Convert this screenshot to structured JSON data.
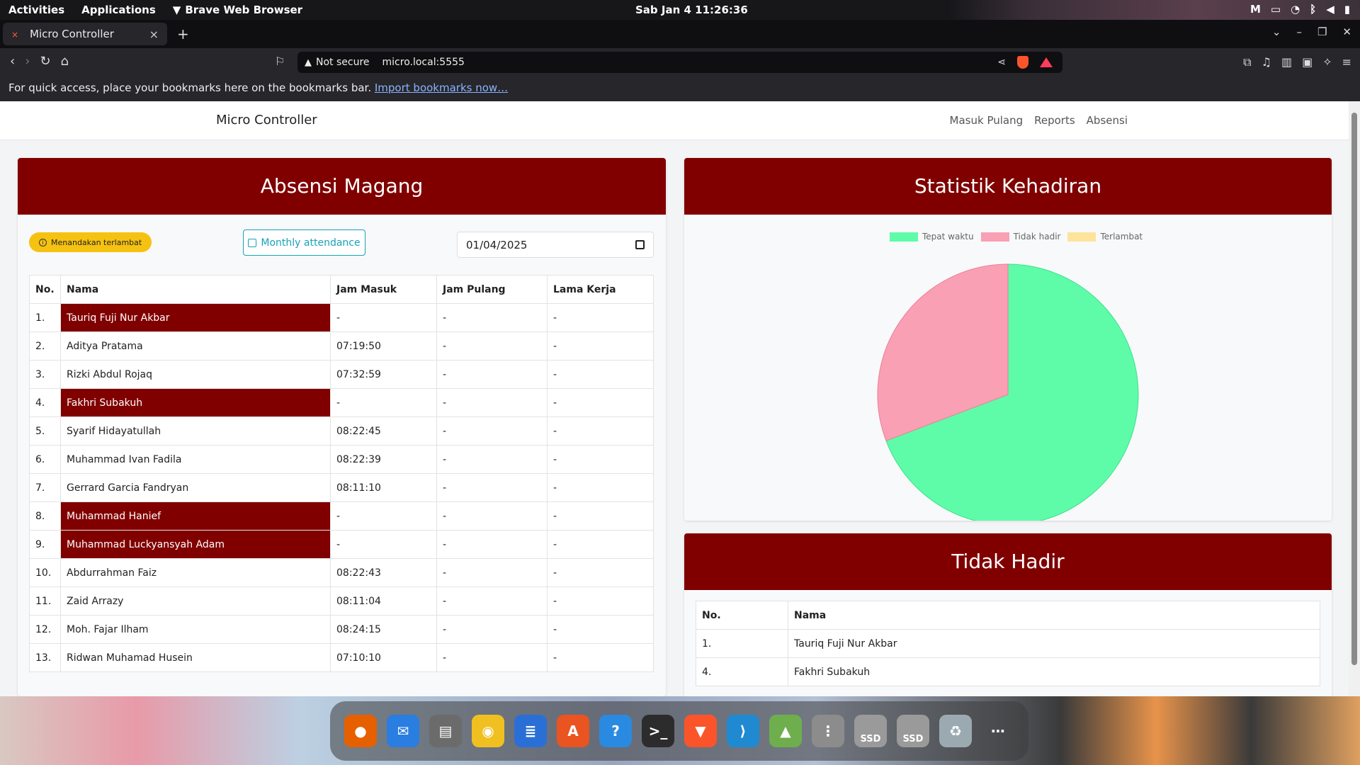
{
  "system": {
    "activities": "Activities",
    "applications": "Applications",
    "active_app": "Brave Web Browser",
    "clock": "Sab Jan 4  11:26:36"
  },
  "browser": {
    "tab_title": "Micro Controller",
    "not_secure": "Not secure",
    "url": "micro.local:5555",
    "bookmarks_text": "For quick access, place your bookmarks here on the bookmarks bar.",
    "bookmarks_link": "Import bookmarks now…"
  },
  "site": {
    "brand": "Micro Controller",
    "nav": [
      "Masuk Pulang",
      "Reports",
      "Absensi"
    ]
  },
  "attendance": {
    "title": "Absensi Magang",
    "late_badge": "Menandakan terlambat",
    "monthly_button": "Monthly attendance",
    "date": "01/04/2025",
    "headers": [
      "No.",
      "Nama",
      "Jam Masuk",
      "Jam Pulang",
      "Lama Kerja"
    ],
    "rows": [
      {
        "no": "1.",
        "nama": "Tauriq Fuji Nur Akbar",
        "masuk": "-",
        "pulang": "-",
        "lama": "-",
        "absent": true
      },
      {
        "no": "2.",
        "nama": "Aditya Pratama",
        "masuk": "07:19:50",
        "pulang": "-",
        "lama": "-",
        "absent": false
      },
      {
        "no": "3.",
        "nama": "Rizki Abdul Rojaq",
        "masuk": "07:32:59",
        "pulang": "-",
        "lama": "-",
        "absent": false
      },
      {
        "no": "4.",
        "nama": "Fakhri Subakuh",
        "masuk": "-",
        "pulang": "-",
        "lama": "-",
        "absent": true
      },
      {
        "no": "5.",
        "nama": "Syarif Hidayatullah",
        "masuk": "08:22:45",
        "pulang": "-",
        "lama": "-",
        "absent": false
      },
      {
        "no": "6.",
        "nama": "Muhammad Ivan Fadila",
        "masuk": "08:22:39",
        "pulang": "-",
        "lama": "-",
        "absent": false
      },
      {
        "no": "7.",
        "nama": "Gerrard Garcia Fandryan",
        "masuk": "08:11:10",
        "pulang": "-",
        "lama": "-",
        "absent": false
      },
      {
        "no": "8.",
        "nama": "Muhammad Hanief",
        "masuk": "-",
        "pulang": "-",
        "lama": "-",
        "absent": true
      },
      {
        "no": "9.",
        "nama": "Muhammad Luckyansyah Adam",
        "masuk": "-",
        "pulang": "-",
        "lama": "-",
        "absent": true
      },
      {
        "no": "10.",
        "nama": "Abdurrahman Faiz",
        "masuk": "08:22:43",
        "pulang": "-",
        "lama": "-",
        "absent": false
      },
      {
        "no": "11.",
        "nama": "Zaid Arrazy",
        "masuk": "08:11:04",
        "pulang": "-",
        "lama": "-",
        "absent": false
      },
      {
        "no": "12.",
        "nama": "Moh. Fajar Ilham",
        "masuk": "08:24:15",
        "pulang": "-",
        "lama": "-",
        "absent": false
      },
      {
        "no": "13.",
        "nama": "Ridwan Muhamad Husein",
        "masuk": "07:10:10",
        "pulang": "-",
        "lama": "-",
        "absent": false
      }
    ]
  },
  "statistics": {
    "title": "Statistik Kehadiran"
  },
  "chart_data": {
    "type": "pie",
    "title": "Statistik Kehadiran",
    "categories": [
      "Tepat waktu",
      "Tidak hadir",
      "Terlambat"
    ],
    "values": [
      9,
      4,
      0
    ],
    "colors": [
      "#5efca8",
      "#f9a0b4",
      "#fde49a"
    ],
    "legend": "top"
  },
  "absent": {
    "title": "Tidak Hadir",
    "headers": [
      "No.",
      "Nama"
    ],
    "rows": [
      {
        "no": "1.",
        "nama": "Tauriq Fuji Nur Akbar"
      },
      {
        "no": "4.",
        "nama": "Fakhri Subakuh"
      }
    ]
  },
  "dock": {
    "items": [
      "firefox-icon",
      "thunderbird-icon",
      "files-icon",
      "rhythmbox-icon",
      "writer-icon",
      "app-center-icon",
      "help-icon",
      "terminal-icon",
      "brave-icon",
      "vscode-icon",
      "image-viewer-icon",
      "disk-icon",
      "ssd-icon",
      "ssd-icon",
      "trash-icon",
      "app-grid-icon"
    ],
    "ssd_label": "SSD"
  }
}
